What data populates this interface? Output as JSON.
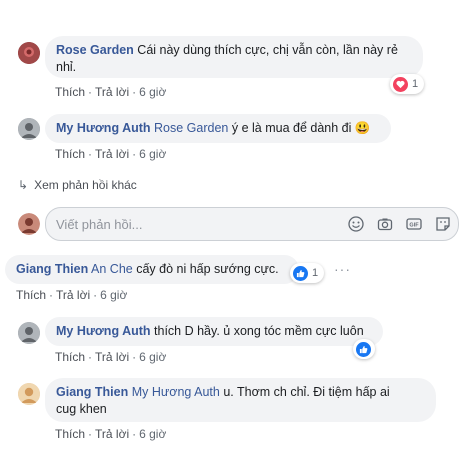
{
  "comments": [
    {
      "author": "Rose Garden",
      "text": "Cái này dùng thích cực, chị vẫn còn, lần này rẻ nhỉ.",
      "line1": "Cái này dùng thích cực, chị vẫn còn, lần này rẻ",
      "line2": "nhỉ.",
      "actions": {
        "like": "Thích",
        "reply": "Trả lời",
        "time": "6 giờ"
      },
      "reaction": {
        "type": "love",
        "count": "1"
      }
    },
    {
      "author": "My Hương Auth",
      "tag": "Rose Garden",
      "text": "ý e là mua để dành đi",
      "emoji": "😃",
      "actions": {
        "like": "Thích",
        "reply": "Trả lời",
        "time": "6 giờ"
      }
    },
    {
      "author": "Giang Thien",
      "tag": "An Che",
      "text": "cấy đò ni hấp sướng cực.",
      "actions": {
        "like": "Thích",
        "reply": "Trả lời",
        "time": "6 giờ"
      },
      "reaction": {
        "type": "like",
        "count": "1"
      },
      "more": "···"
    },
    {
      "author": "My Hương Auth",
      "text": "thích D hầy. ủ xong tóc mềm cực luôn",
      "actions": {
        "like": "Thích",
        "reply": "Trả lời",
        "time": "6 giờ"
      },
      "reaction": {
        "type": "like",
        "count": ""
      }
    },
    {
      "author": "Giang Thien",
      "tag": "My Hương Auth",
      "line1": "u. Thơm ch chỉ. Đi tiệm hấp ai",
      "line2": "cug khen",
      "actions": {
        "like": "Thích",
        "reply": "Trả lời",
        "time": "6 giờ"
      }
    }
  ],
  "view_more_replies": "Xem phản hồi khác",
  "reply_input": {
    "placeholder": "Viết phản hồi..."
  },
  "input_icons": [
    "emoji-icon",
    "camera-icon",
    "gif-icon",
    "sticker-icon"
  ],
  "gif_label": "GIF",
  "colors": {
    "name": "#385898",
    "bubble": "#f2f3f5",
    "like": "#1877f2",
    "love": "#f3425f"
  }
}
